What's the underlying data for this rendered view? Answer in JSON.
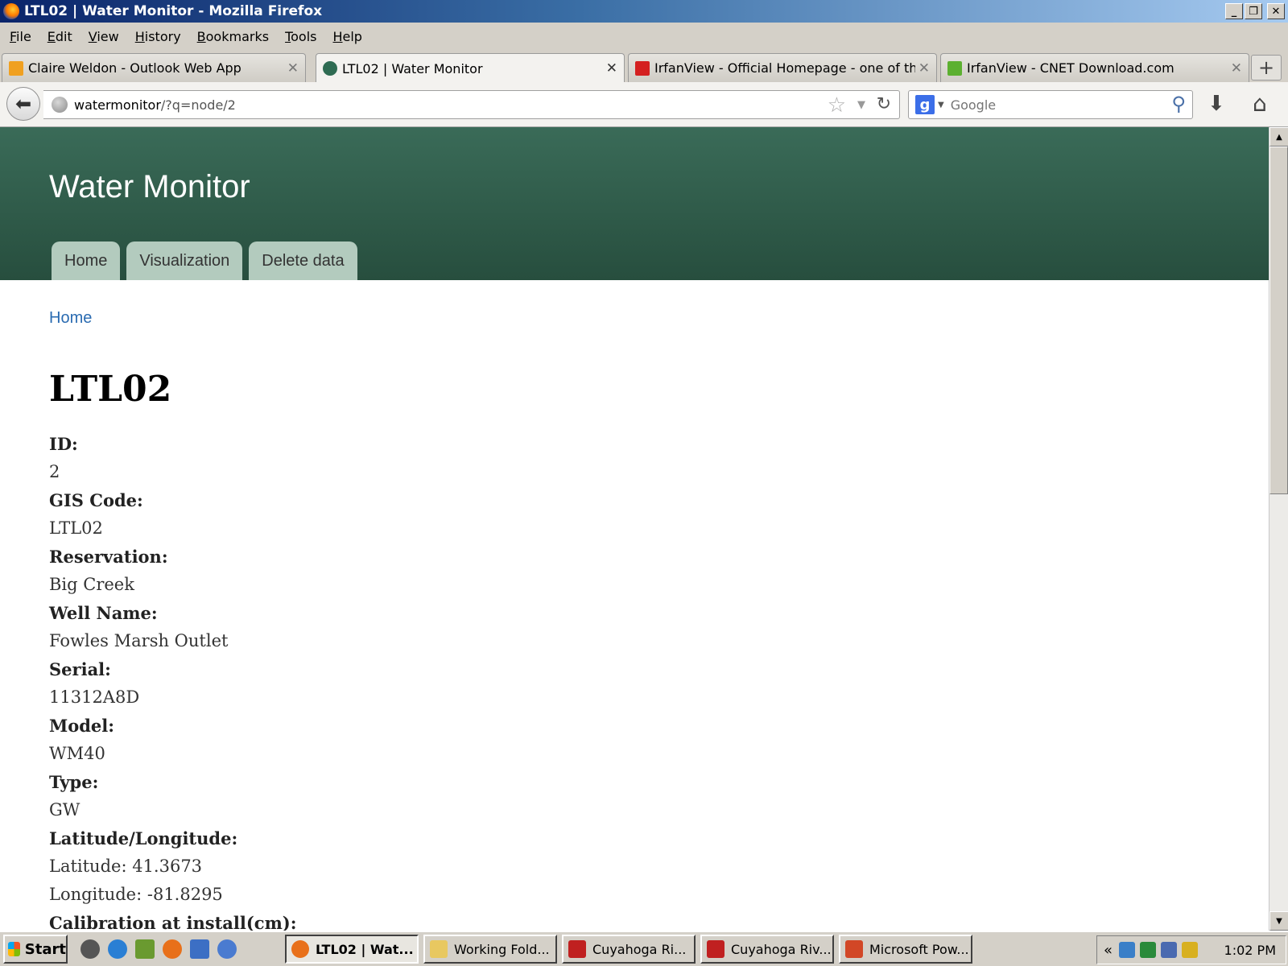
{
  "window": {
    "title": "LTL02 | Water Monitor - Mozilla Firefox",
    "controls": [
      "_",
      "❐",
      "✕"
    ]
  },
  "menubar": [
    "File",
    "Edit",
    "View",
    "History",
    "Bookmarks",
    "Tools",
    "Help"
  ],
  "tabs": [
    {
      "label": "Claire Weldon - Outlook Web App",
      "icon": "outlook-icon",
      "active": false
    },
    {
      "label": "LTL02 | Water Monitor",
      "icon": "water-monitor-icon",
      "active": true
    },
    {
      "label": "IrfanView - Official Homepage - one of th...",
      "icon": "irfanview-icon",
      "active": false
    },
    {
      "label": "IrfanView - CNET Download.com",
      "icon": "cnet-icon",
      "active": false
    }
  ],
  "navbar": {
    "url_host": "watermonitor",
    "url_path": "/?q=node/2",
    "search_placeholder": "Google"
  },
  "site": {
    "name": "Water Monitor",
    "tabs": [
      "Home",
      "Visualization",
      "Delete data"
    ],
    "breadcrumb": "Home",
    "node_title": "LTL02",
    "fields": [
      {
        "label": "ID:",
        "values": [
          "2"
        ]
      },
      {
        "label": "GIS Code:",
        "values": [
          "LTL02"
        ]
      },
      {
        "label": "Reservation:",
        "values": [
          "Big Creek"
        ]
      },
      {
        "label": "Well Name:",
        "values": [
          "Fowles Marsh Outlet"
        ]
      },
      {
        "label": "Serial:",
        "values": [
          "11312A8D"
        ]
      },
      {
        "label": "Model:",
        "values": [
          "WM40"
        ]
      },
      {
        "label": "Type:",
        "values": [
          "GW"
        ]
      },
      {
        "label": "Latitude/Longitude:",
        "values": [
          "Latitude: 41.3673",
          "Longitude: -81.8295"
        ]
      },
      {
        "label": "Calibration at install(cm):",
        "values": []
      }
    ]
  },
  "taskbar": {
    "start": "Start",
    "items": [
      {
        "label": "LTL02 | Wat...",
        "active": true
      },
      {
        "label": "Working Fold...",
        "active": false
      },
      {
        "label": "Cuyahoga Ri...",
        "active": false
      },
      {
        "label": "Cuyahoga Riv...",
        "active": false
      },
      {
        "label": "Microsoft Pow...",
        "active": false
      }
    ],
    "clock": "1:02 PM"
  },
  "colors": {
    "header_green": "#2f5b48",
    "site_tab": "#b3cbbe",
    "link_blue": "#2a6bb1",
    "titlebar_blue": "#0a246a"
  }
}
